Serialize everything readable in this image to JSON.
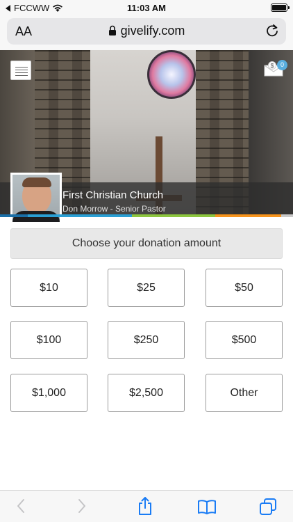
{
  "status": {
    "carrier": "FCCWW",
    "time": "11:03 AM"
  },
  "browser": {
    "aa_label": "AA",
    "url": "givelify.com"
  },
  "hero": {
    "church_name": "First Christian Church",
    "pastor": "Don Morrow - Senior Pastor",
    "message_count": "0"
  },
  "colors": {
    "strip": [
      "#1a6fa8",
      "#2a9fd4",
      "#8dc63f",
      "#f7941d",
      "#c9c9c9"
    ],
    "accent": "#5aaede"
  },
  "donation": {
    "header": "Choose your donation amount",
    "amounts": [
      "$10",
      "$25",
      "$50",
      "$100",
      "$250",
      "$500",
      "$1,000",
      "$2,500",
      "Other"
    ]
  },
  "icons": {
    "status": [
      "back-arrow-icon",
      "wifi-icon",
      "battery-icon"
    ],
    "address_bar": [
      "lock-icon",
      "reload-icon"
    ],
    "hero": [
      "menu-icon",
      "envelope-dollar-icon"
    ],
    "toolbar": [
      "back-icon",
      "forward-icon",
      "share-icon",
      "bookmarks-icon",
      "tabs-icon"
    ]
  }
}
